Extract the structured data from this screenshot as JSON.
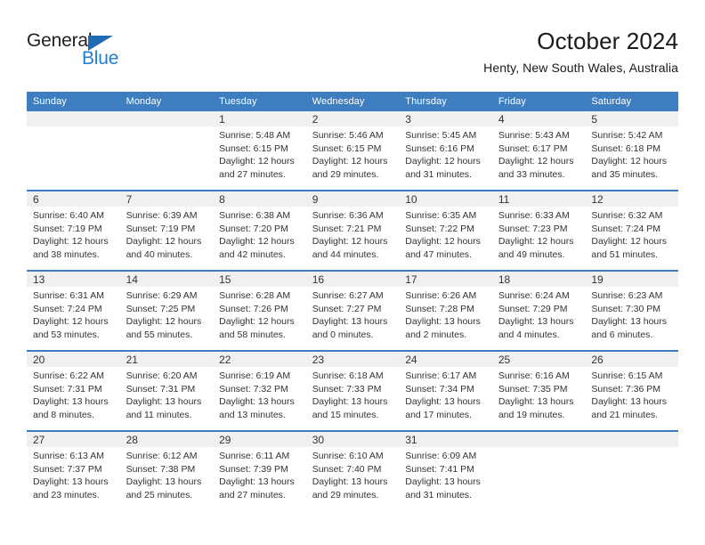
{
  "brand": {
    "name_dark": "General",
    "name_blue": "Blue",
    "color_dark": "#231f20",
    "color_blue": "#1f7fd4",
    "triangle_color": "#1f6cb4"
  },
  "header": {
    "title": "October 2024",
    "subtitle": "Henty, New South Wales, Australia",
    "header_bg": "#3c7ebf",
    "header_text": "#ffffff",
    "date_strip_bg": "#f0f0f0"
  },
  "weekdays": [
    "Sunday",
    "Monday",
    "Tuesday",
    "Wednesday",
    "Thursday",
    "Friday",
    "Saturday"
  ],
  "weeks": [
    {
      "days": [
        {
          "num": "",
          "sunrise": "",
          "sunset": "",
          "daylight1": "",
          "daylight2": ""
        },
        {
          "num": "",
          "sunrise": "",
          "sunset": "",
          "daylight1": "",
          "daylight2": ""
        },
        {
          "num": "1",
          "sunrise": "Sunrise: 5:48 AM",
          "sunset": "Sunset: 6:15 PM",
          "daylight1": "Daylight: 12 hours",
          "daylight2": "and 27 minutes."
        },
        {
          "num": "2",
          "sunrise": "Sunrise: 5:46 AM",
          "sunset": "Sunset: 6:15 PM",
          "daylight1": "Daylight: 12 hours",
          "daylight2": "and 29 minutes."
        },
        {
          "num": "3",
          "sunrise": "Sunrise: 5:45 AM",
          "sunset": "Sunset: 6:16 PM",
          "daylight1": "Daylight: 12 hours",
          "daylight2": "and 31 minutes."
        },
        {
          "num": "4",
          "sunrise": "Sunrise: 5:43 AM",
          "sunset": "Sunset: 6:17 PM",
          "daylight1": "Daylight: 12 hours",
          "daylight2": "and 33 minutes."
        },
        {
          "num": "5",
          "sunrise": "Sunrise: 5:42 AM",
          "sunset": "Sunset: 6:18 PM",
          "daylight1": "Daylight: 12 hours",
          "daylight2": "and 35 minutes."
        }
      ]
    },
    {
      "days": [
        {
          "num": "6",
          "sunrise": "Sunrise: 6:40 AM",
          "sunset": "Sunset: 7:19 PM",
          "daylight1": "Daylight: 12 hours",
          "daylight2": "and 38 minutes."
        },
        {
          "num": "7",
          "sunrise": "Sunrise: 6:39 AM",
          "sunset": "Sunset: 7:19 PM",
          "daylight1": "Daylight: 12 hours",
          "daylight2": "and 40 minutes."
        },
        {
          "num": "8",
          "sunrise": "Sunrise: 6:38 AM",
          "sunset": "Sunset: 7:20 PM",
          "daylight1": "Daylight: 12 hours",
          "daylight2": "and 42 minutes."
        },
        {
          "num": "9",
          "sunrise": "Sunrise: 6:36 AM",
          "sunset": "Sunset: 7:21 PM",
          "daylight1": "Daylight: 12 hours",
          "daylight2": "and 44 minutes."
        },
        {
          "num": "10",
          "sunrise": "Sunrise: 6:35 AM",
          "sunset": "Sunset: 7:22 PM",
          "daylight1": "Daylight: 12 hours",
          "daylight2": "and 47 minutes."
        },
        {
          "num": "11",
          "sunrise": "Sunrise: 6:33 AM",
          "sunset": "Sunset: 7:23 PM",
          "daylight1": "Daylight: 12 hours",
          "daylight2": "and 49 minutes."
        },
        {
          "num": "12",
          "sunrise": "Sunrise: 6:32 AM",
          "sunset": "Sunset: 7:24 PM",
          "daylight1": "Daylight: 12 hours",
          "daylight2": "and 51 minutes."
        }
      ]
    },
    {
      "days": [
        {
          "num": "13",
          "sunrise": "Sunrise: 6:31 AM",
          "sunset": "Sunset: 7:24 PM",
          "daylight1": "Daylight: 12 hours",
          "daylight2": "and 53 minutes."
        },
        {
          "num": "14",
          "sunrise": "Sunrise: 6:29 AM",
          "sunset": "Sunset: 7:25 PM",
          "daylight1": "Daylight: 12 hours",
          "daylight2": "and 55 minutes."
        },
        {
          "num": "15",
          "sunrise": "Sunrise: 6:28 AM",
          "sunset": "Sunset: 7:26 PM",
          "daylight1": "Daylight: 12 hours",
          "daylight2": "and 58 minutes."
        },
        {
          "num": "16",
          "sunrise": "Sunrise: 6:27 AM",
          "sunset": "Sunset: 7:27 PM",
          "daylight1": "Daylight: 13 hours",
          "daylight2": "and 0 minutes."
        },
        {
          "num": "17",
          "sunrise": "Sunrise: 6:26 AM",
          "sunset": "Sunset: 7:28 PM",
          "daylight1": "Daylight: 13 hours",
          "daylight2": "and 2 minutes."
        },
        {
          "num": "18",
          "sunrise": "Sunrise: 6:24 AM",
          "sunset": "Sunset: 7:29 PM",
          "daylight1": "Daylight: 13 hours",
          "daylight2": "and 4 minutes."
        },
        {
          "num": "19",
          "sunrise": "Sunrise: 6:23 AM",
          "sunset": "Sunset: 7:30 PM",
          "daylight1": "Daylight: 13 hours",
          "daylight2": "and 6 minutes."
        }
      ]
    },
    {
      "days": [
        {
          "num": "20",
          "sunrise": "Sunrise: 6:22 AM",
          "sunset": "Sunset: 7:31 PM",
          "daylight1": "Daylight: 13 hours",
          "daylight2": "and 8 minutes."
        },
        {
          "num": "21",
          "sunrise": "Sunrise: 6:20 AM",
          "sunset": "Sunset: 7:31 PM",
          "daylight1": "Daylight: 13 hours",
          "daylight2": "and 11 minutes."
        },
        {
          "num": "22",
          "sunrise": "Sunrise: 6:19 AM",
          "sunset": "Sunset: 7:32 PM",
          "daylight1": "Daylight: 13 hours",
          "daylight2": "and 13 minutes."
        },
        {
          "num": "23",
          "sunrise": "Sunrise: 6:18 AM",
          "sunset": "Sunset: 7:33 PM",
          "daylight1": "Daylight: 13 hours",
          "daylight2": "and 15 minutes."
        },
        {
          "num": "24",
          "sunrise": "Sunrise: 6:17 AM",
          "sunset": "Sunset: 7:34 PM",
          "daylight1": "Daylight: 13 hours",
          "daylight2": "and 17 minutes."
        },
        {
          "num": "25",
          "sunrise": "Sunrise: 6:16 AM",
          "sunset": "Sunset: 7:35 PM",
          "daylight1": "Daylight: 13 hours",
          "daylight2": "and 19 minutes."
        },
        {
          "num": "26",
          "sunrise": "Sunrise: 6:15 AM",
          "sunset": "Sunset: 7:36 PM",
          "daylight1": "Daylight: 13 hours",
          "daylight2": "and 21 minutes."
        }
      ]
    },
    {
      "days": [
        {
          "num": "27",
          "sunrise": "Sunrise: 6:13 AM",
          "sunset": "Sunset: 7:37 PM",
          "daylight1": "Daylight: 13 hours",
          "daylight2": "and 23 minutes."
        },
        {
          "num": "28",
          "sunrise": "Sunrise: 6:12 AM",
          "sunset": "Sunset: 7:38 PM",
          "daylight1": "Daylight: 13 hours",
          "daylight2": "and 25 minutes."
        },
        {
          "num": "29",
          "sunrise": "Sunrise: 6:11 AM",
          "sunset": "Sunset: 7:39 PM",
          "daylight1": "Daylight: 13 hours",
          "daylight2": "and 27 minutes."
        },
        {
          "num": "30",
          "sunrise": "Sunrise: 6:10 AM",
          "sunset": "Sunset: 7:40 PM",
          "daylight1": "Daylight: 13 hours",
          "daylight2": "and 29 minutes."
        },
        {
          "num": "31",
          "sunrise": "Sunrise: 6:09 AM",
          "sunset": "Sunset: 7:41 PM",
          "daylight1": "Daylight: 13 hours",
          "daylight2": "and 31 minutes."
        },
        {
          "num": "",
          "sunrise": "",
          "sunset": "",
          "daylight1": "",
          "daylight2": ""
        },
        {
          "num": "",
          "sunrise": "",
          "sunset": "",
          "daylight1": "",
          "daylight2": ""
        }
      ]
    }
  ]
}
